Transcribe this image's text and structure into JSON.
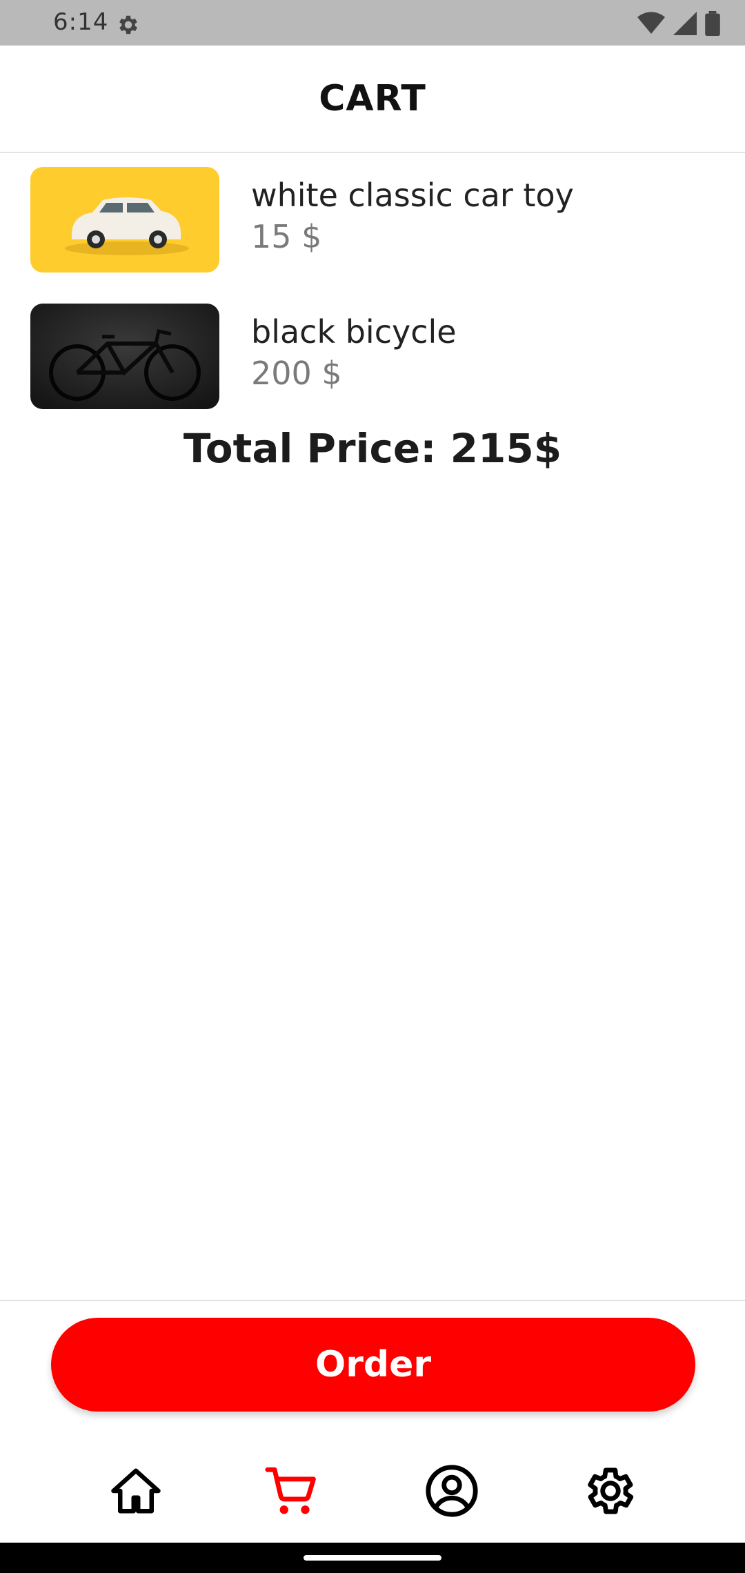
{
  "status_bar": {
    "time": "6:14",
    "icons": [
      "settings-icon",
      "wifi-icon",
      "cellular-signal-icon",
      "battery-icon"
    ]
  },
  "header": {
    "title": "CART"
  },
  "cart": {
    "items": [
      {
        "name": "white classic car toy",
        "price": "15 $",
        "image": "white-car-toy-image"
      },
      {
        "name": "black bicycle",
        "price": "200 $",
        "image": "black-bicycle-image"
      }
    ],
    "total_label": "Total Price: 215$"
  },
  "order_button": {
    "label": "Order"
  },
  "bottom_nav": {
    "items": [
      {
        "icon": "home-icon",
        "active": false
      },
      {
        "icon": "cart-icon",
        "active": true
      },
      {
        "icon": "account-icon",
        "active": false
      },
      {
        "icon": "settings-icon",
        "active": false
      }
    ]
  },
  "colors": {
    "accent": "#ff0000",
    "status_bar": "#b9b9b9",
    "price_text": "#7a7a7a",
    "car_image_bg": "#ffcc2e",
    "bicycle_image_bg": "#1f1f1f"
  }
}
